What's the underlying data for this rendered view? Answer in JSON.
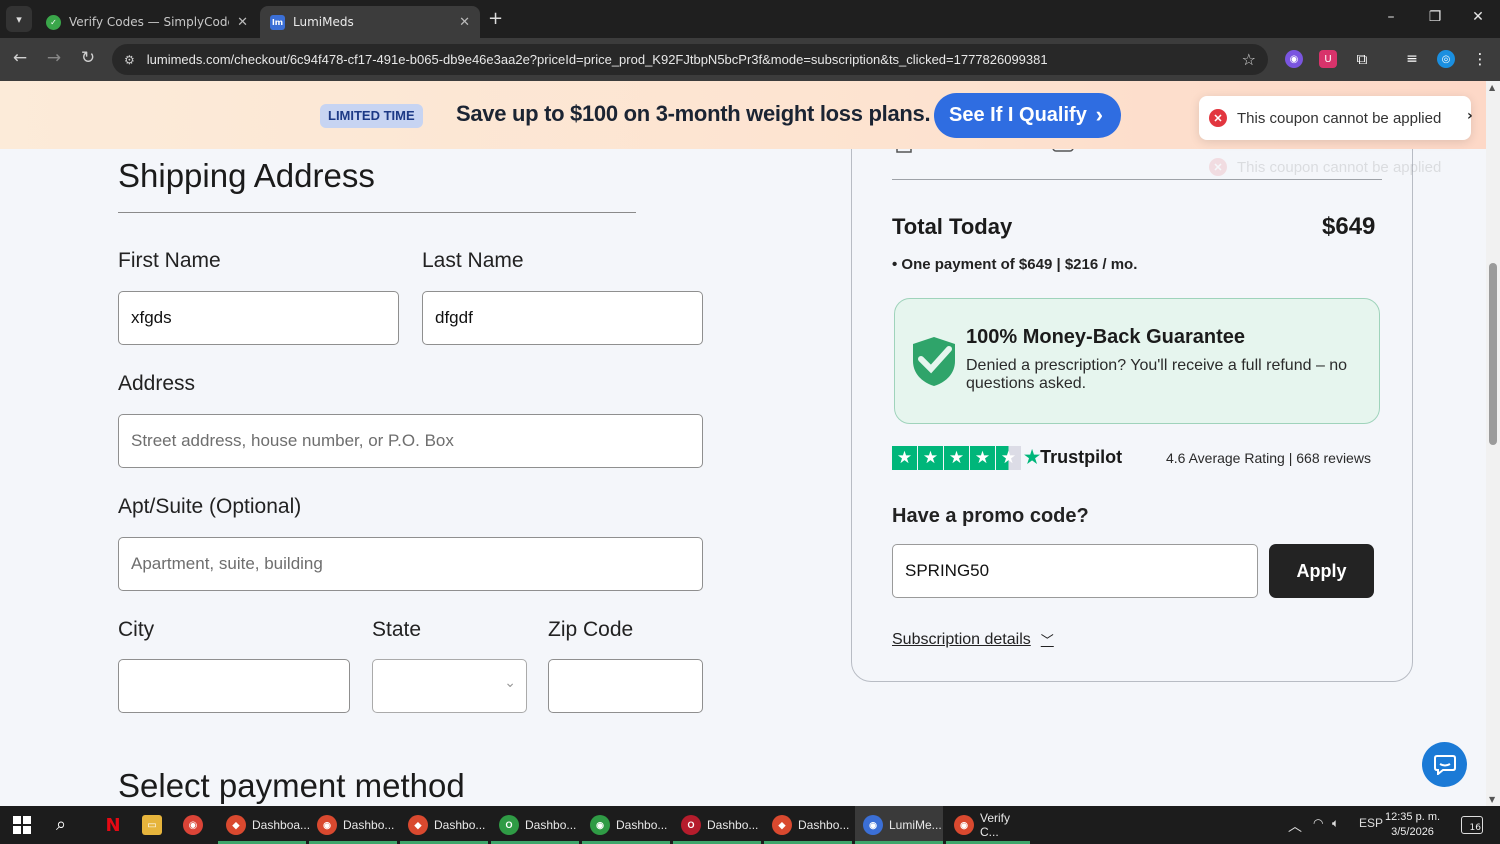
{
  "browser": {
    "tabs": [
      {
        "title": "Verify Codes — SimplyCodes",
        "favicon": "SC",
        "favicon_color": "#3aa64a",
        "active": false
      },
      {
        "title": "LumiMeds",
        "favicon": "lm",
        "favicon_color": "#3b6fd6",
        "active": true
      }
    ],
    "new_tab": "+",
    "url": "lumimeds.com/checkout/6c94f478-cf17-491e-b065-db9e46e3aa2e?priceId=price_prod_K92FJtbpN5bcPr3f&mode=subscription&ts_clicked=1777826099381"
  },
  "banner": {
    "badge": "LIMITED TIME",
    "text": "Save up to $100 on 3-month weight loss plans.",
    "cta": "See If I Qualify"
  },
  "toast": {
    "message": "This coupon cannot be applied",
    "ghost_message": "This coupon cannot be applied",
    "error_color": "#e2363f"
  },
  "form": {
    "heading": "Shipping Address",
    "first_name": {
      "label": "First Name",
      "value": "xfgds"
    },
    "last_name": {
      "label": "Last Name",
      "value": "dfgdf"
    },
    "address": {
      "label": "Address",
      "placeholder": "Street address, house number, or P.O. Box",
      "value": ""
    },
    "apt": {
      "label": "Apt/Suite (Optional)",
      "placeholder": "Apartment, suite, building",
      "value": ""
    },
    "city": {
      "label": "City",
      "value": ""
    },
    "state": {
      "label": "State",
      "value": ""
    },
    "zip": {
      "label": "Zip Code",
      "value": ""
    },
    "payment_heading": "Select payment method"
  },
  "summary": {
    "total_label": "Total Today",
    "total_value": "$649",
    "payment_note": "• One payment of $649 | $216 / mo.",
    "guarantee": {
      "title": "100% Money-Back Guarantee",
      "description": "Denied a prescription? You'll receive a full refund – no questions asked."
    },
    "trustpilot": {
      "name": "Trustpilot",
      "rating_text": "4.6 Average Rating | 668 reviews",
      "stars": 4.5,
      "color": "#00b67a"
    },
    "promo": {
      "label": "Have a promo code?",
      "value": "SPRING50",
      "apply": "Apply"
    },
    "subscription_details": "Subscription details"
  },
  "taskbar": {
    "apps": [
      {
        "label": "Dashboa...",
        "color": "#d9492f"
      },
      {
        "label": "Dashbo...",
        "color": "#d9492f"
      },
      {
        "label": "Dashbo...",
        "color": "#d9492f"
      },
      {
        "label": "Dashbo...",
        "color": "#2f9b45"
      },
      {
        "label": "Dashbo...",
        "color": "#2f9b45"
      },
      {
        "label": "Dashbo...",
        "color": "#b51c2c"
      },
      {
        "label": "Dashbo...",
        "color": "#d9492f"
      },
      {
        "label": "LumiMe...",
        "color": "#3b6fd6"
      },
      {
        "label": "Verify C...",
        "color": "#d9492f"
      }
    ],
    "language": "ESP",
    "time": "12:35 p. m.",
    "date": "3/5/2026",
    "notifications": "16"
  }
}
